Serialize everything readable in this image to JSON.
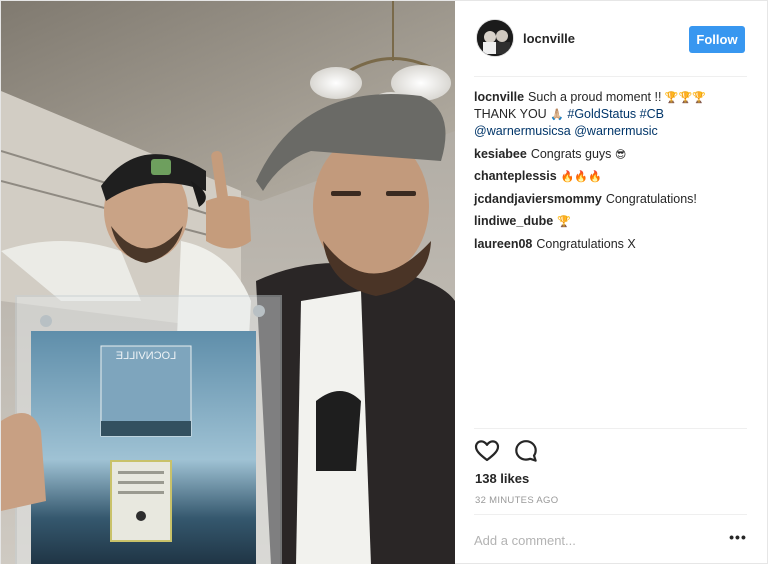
{
  "post": {
    "author": "locnville",
    "follow_label": "Follow",
    "caption": {
      "user": "locnville",
      "line1_text": "Such a proud moment !!",
      "line1_emoji": "🏆🏆🏆",
      "line2_text": "THANK YOU",
      "line2_emoji": "🙏🏼",
      "hashtag1": "#GoldStatus",
      "hashtag2": "#CB",
      "mention1": "@warnermusicsa",
      "mention2": "@warnermusic"
    },
    "comments": [
      {
        "user": "kesiabee",
        "text": "Congrats guys",
        "emoji": "😎"
      },
      {
        "user": "chanteplessis",
        "text": "",
        "emoji": "🔥🔥🔥"
      },
      {
        "user": "jcdandjaviersmommy",
        "text": "Congratulations!",
        "emoji": ""
      },
      {
        "user": "lindiwe_dube",
        "text": "",
        "emoji": "🏆"
      },
      {
        "user": "laureen08",
        "text": "Congratulations X",
        "emoji": ""
      }
    ],
    "likes": "138 likes",
    "time_ago": "32 MINUTES AGO",
    "comment_placeholder": "Add a comment...",
    "more_label": "•••",
    "plaque": {
      "album_title": "LOCNVILLE"
    }
  },
  "icons": {
    "like": "heart-icon",
    "comment": "speech-bubble-icon",
    "more": "more-options-icon"
  },
  "colors": {
    "follow_button": "#3897f0",
    "link": "#003569",
    "muted": "#999999"
  }
}
